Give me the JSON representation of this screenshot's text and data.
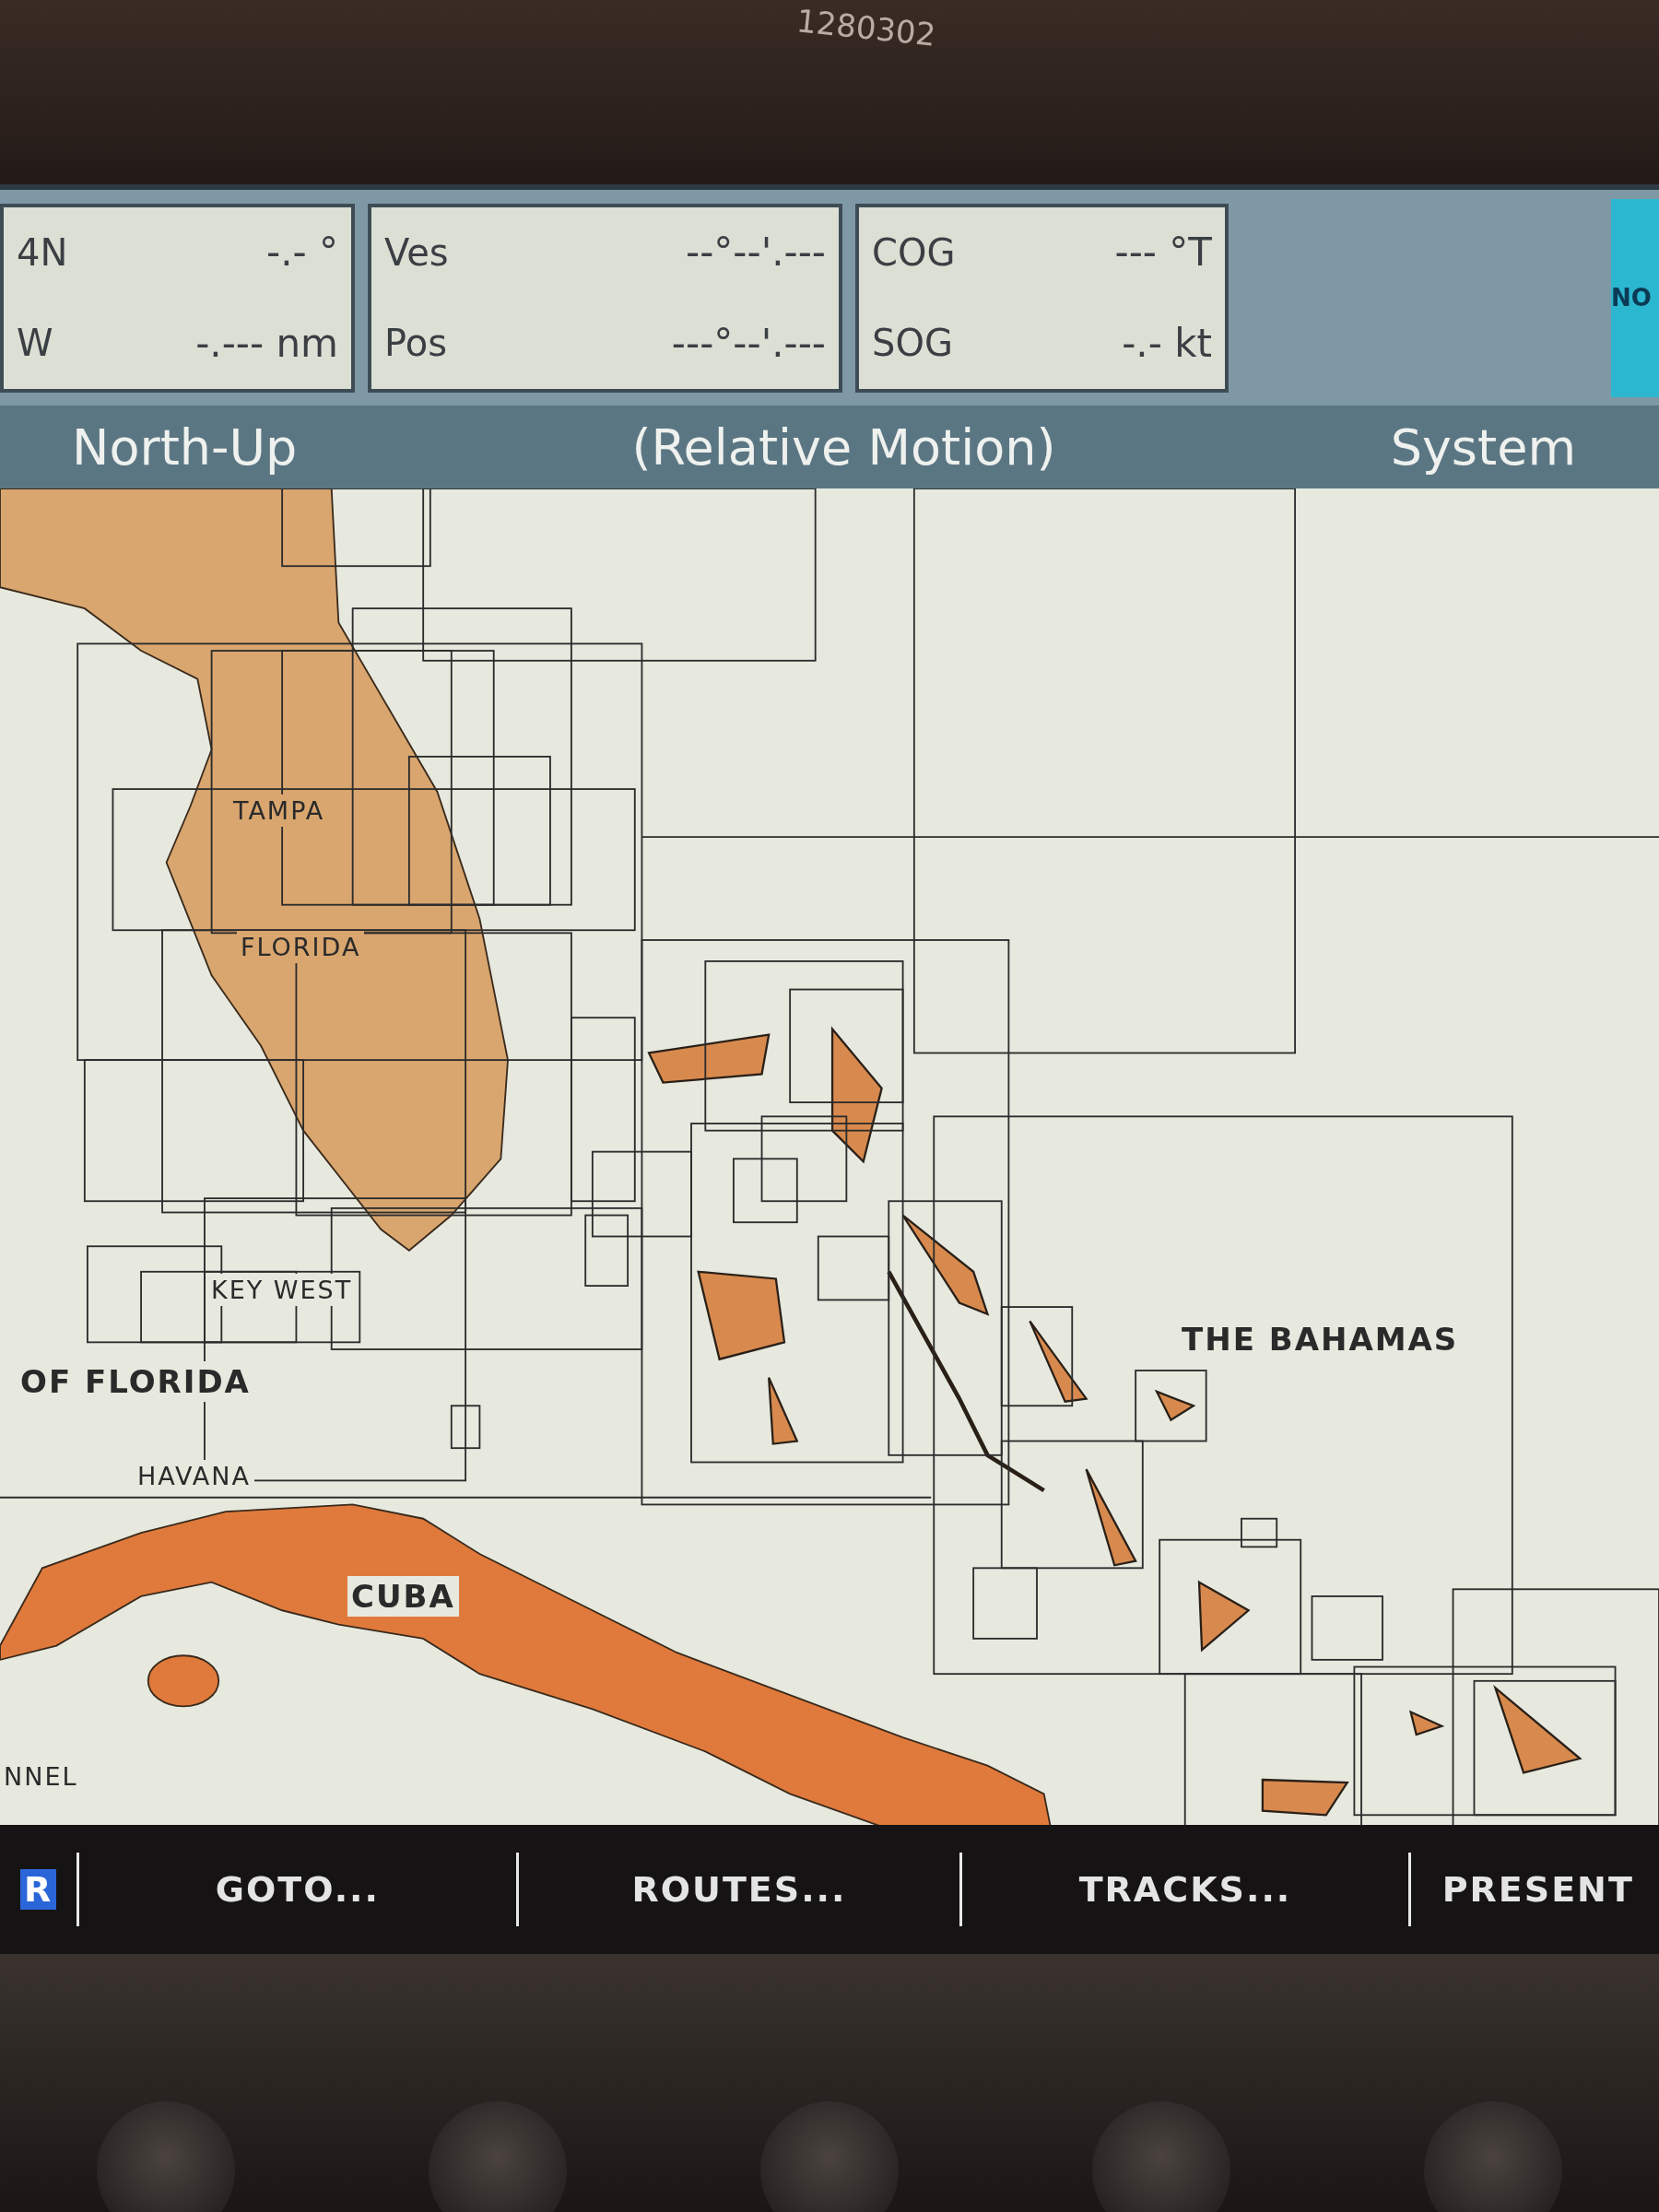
{
  "bezel": {
    "label": "1280302"
  },
  "info_panels": [
    {
      "rows": [
        {
          "label": "4N",
          "value": "-.- °"
        },
        {
          "label": "W",
          "value": "-.--- nm"
        }
      ]
    },
    {
      "rows": [
        {
          "label": "Ves",
          "value": "--°--'.---"
        },
        {
          "label": "Pos",
          "value": "---°--'.---"
        }
      ]
    },
    {
      "rows": [
        {
          "label": "COG",
          "value": "--- °T"
        },
        {
          "label": "SOG",
          "value": "-.- kt"
        }
      ]
    }
  ],
  "logo": {
    "text": "NO"
  },
  "mode_bar": {
    "orientation": "North-Up",
    "motion": "(Relative Motion)",
    "menu": "System"
  },
  "map": {
    "labels": [
      {
        "text": "TAMPA",
        "kind": "place"
      },
      {
        "text": "FLORIDA",
        "kind": "place"
      },
      {
        "text": "KEY WEST",
        "kind": "place"
      },
      {
        "text": "OF FLORIDA",
        "kind": "region"
      },
      {
        "text": "HAVANA",
        "kind": "place"
      },
      {
        "text": "CUBA",
        "kind": "country"
      },
      {
        "text": "THE BAHAMAS",
        "kind": "region"
      },
      {
        "text": "NNEL",
        "kind": "place"
      }
    ]
  },
  "soft_keys": [
    {
      "label": "R",
      "selected": true
    },
    {
      "label": "GOTO...",
      "selected": false
    },
    {
      "label": "ROUTES...",
      "selected": false
    },
    {
      "label": "TRACKS...",
      "selected": false
    },
    {
      "label": "PRESENT",
      "selected": false
    }
  ]
}
